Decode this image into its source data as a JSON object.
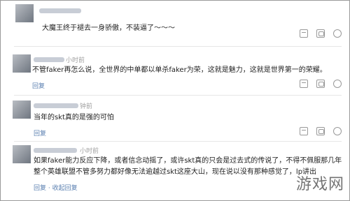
{
  "comments": [
    {
      "username": "",
      "time": "",
      "text_lines": [
        "大魔王终于褪去一身骄傲，不装逼了～～～"
      ],
      "reply_label": ""
    },
    {
      "username": "",
      "time": "小时前",
      "text_lines": [
        "不管faker再怎么说，全世界的中单都以单杀faker为荣，这就是魅力，这就是世界第一的荣耀。"
      ],
      "reply_label": "回复"
    },
    {
      "username": "",
      "time": "钟前",
      "text_lines": [
        "当年的skt真的是强的可怕"
      ],
      "reply_label": "回复"
    },
    {
      "username": "",
      "time": "小时前",
      "text_lines": [
        "如果faker能力反应下降，或者信念动摇了，或许skt真的只会是过去式的传说了，不得不佩服那几年",
        "整个英雄联盟不管多努力都好像无法逾越过skt这座大山，现在说以没有那种感觉了，lp讲出"
      ],
      "reply_label": "回复 · 收起回复"
    }
  ],
  "watermark": "游戏网",
  "colors": {
    "username": "#9aa6c2",
    "reply_link": "#5a7fb0"
  },
  "icons": [
    "thumbs-up-icon",
    "comment-icon",
    "share-icon"
  ]
}
